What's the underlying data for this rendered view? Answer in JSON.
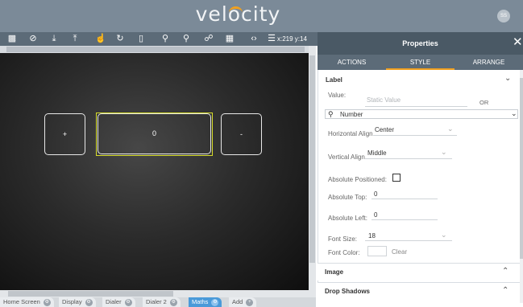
{
  "app": {
    "logo": "velocity",
    "avatar_initials": "SS",
    "accent": "#f0a020",
    "topbar_color": "#7b8a98",
    "active_tab_color": "#4a9ad9",
    "selection_color": "#d7dd2a"
  },
  "toolbar": {
    "icons": [
      "screen-preview-icon",
      "no-rotate-icon",
      "download-icon",
      "upload-icon",
      "touch-icon",
      "refresh-icon",
      "device-icon",
      "zoom-out-icon",
      "zoom-in-icon",
      "lock-icon",
      "grid-icon",
      "code-icon",
      "sliders-icon"
    ],
    "coords": "x:219 y:14"
  },
  "canvas": {
    "plus_label": "+",
    "value_label": "0",
    "minus_label": "-"
  },
  "screen_tabs": [
    {
      "label": "Home Screen"
    },
    {
      "label": "Display"
    },
    {
      "label": "Dialer"
    },
    {
      "label": "Dialer 2"
    },
    {
      "label": "Maths"
    },
    {
      "label": "Add"
    }
  ],
  "properties": {
    "title": "Properties",
    "close": "✕",
    "tabs": [
      "ACTIONS",
      "STYLE",
      "ARRANGE"
    ],
    "active_tab": "STYLE",
    "label_section": {
      "title": "Label",
      "value_label": "Value:",
      "value_placeholder": "Static Value",
      "or_text": "OR",
      "type_value": "Number",
      "h_align_label": "Horizontal Align",
      "h_align_value": "Center",
      "v_align_label": "Vertical Align",
      "v_align_value": "Middle",
      "abs_pos_label": "Absolute Positioned:",
      "abs_top_label": "Absolute Top:",
      "abs_top_value": "0",
      "abs_left_label": "Absolute Left:",
      "abs_left_value": "0",
      "font_size_label": "Font Size:",
      "font_size_value": "18",
      "font_color_label": "Font Color:",
      "clear_label": "Clear"
    },
    "sections": [
      "Image",
      "Drop Shadows"
    ]
  }
}
